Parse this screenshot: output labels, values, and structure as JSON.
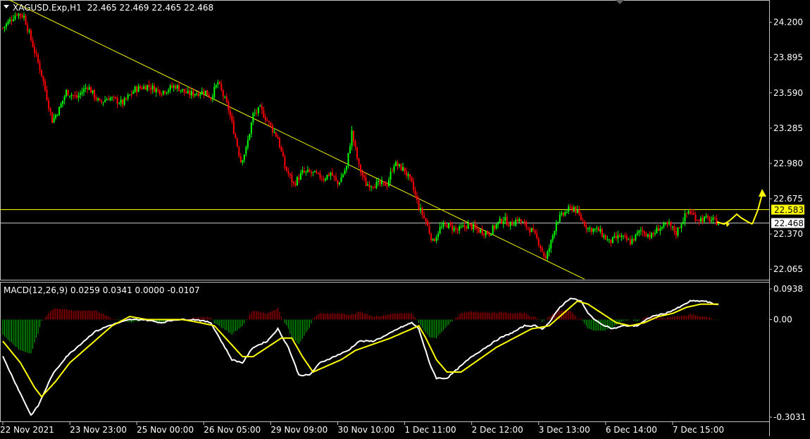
{
  "chart_data": [
    {
      "type": "candlestick",
      "title": "XAGUSD.Exp,H1",
      "ohlc_label": "22.465 22.469 22.465 22.468",
      "y_ticks": [
        "24.200",
        "23.895",
        "23.590",
        "23.285",
        "22.980",
        "22.675",
        "22.370",
        "22.065"
      ],
      "y_tick_values": [
        24.2,
        23.895,
        23.59,
        23.285,
        22.98,
        22.675,
        22.37,
        22.065
      ],
      "ylim": [
        21.975,
        24.38
      ],
      "price_levels": [
        {
          "value": 22.583,
          "label": "22.583",
          "color": "#ffff00",
          "label_bg": "#ffff00",
          "label_color": "#000000"
        },
        {
          "value": 22.468,
          "label": "22.468",
          "color": "#c0c0c0",
          "label_bg": "#ffffff",
          "label_color": "#000000"
        }
      ],
      "trendline": {
        "from": [
          0,
          24.42
        ],
        "to": [
          330,
          21.98
        ],
        "color": "#ffff00"
      },
      "bull_color": "#00ff00",
      "bear_color": "#ff0000",
      "anchors": [
        [
          0,
          24.15
        ],
        [
          8,
          24.28
        ],
        [
          12,
          24.25
        ],
        [
          18,
          23.95
        ],
        [
          22,
          23.75
        ],
        [
          28,
          23.35
        ],
        [
          32,
          23.45
        ],
        [
          36,
          23.6
        ],
        [
          42,
          23.55
        ],
        [
          48,
          23.65
        ],
        [
          55,
          23.5
        ],
        [
          60,
          23.55
        ],
        [
          68,
          23.5
        ],
        [
          75,
          23.62
        ],
        [
          82,
          23.65
        ],
        [
          90,
          23.6
        ],
        [
          98,
          23.65
        ],
        [
          105,
          23.58
        ],
        [
          115,
          23.6
        ],
        [
          118,
          23.55
        ],
        [
          122,
          23.68
        ],
        [
          128,
          23.45
        ],
        [
          132,
          23.2
        ],
        [
          135,
          23.0
        ],
        [
          138,
          23.1
        ],
        [
          142,
          23.4
        ],
        [
          146,
          23.45
        ],
        [
          150,
          23.35
        ],
        [
          156,
          23.2
        ],
        [
          160,
          22.95
        ],
        [
          165,
          22.8
        ],
        [
          170,
          22.9
        ],
        [
          175,
          22.9
        ],
        [
          182,
          22.85
        ],
        [
          186,
          22.9
        ],
        [
          190,
          22.8
        ],
        [
          195,
          22.95
        ],
        [
          198,
          23.25
        ],
        [
          202,
          22.95
        ],
        [
          206,
          22.8
        ],
        [
          212,
          22.8
        ],
        [
          218,
          22.8
        ],
        [
          222,
          22.98
        ],
        [
          228,
          22.92
        ],
        [
          232,
          22.8
        ],
        [
          236,
          22.6
        ],
        [
          240,
          22.48
        ],
        [
          244,
          22.3
        ],
        [
          248,
          22.42
        ],
        [
          252,
          22.45
        ],
        [
          258,
          22.4
        ],
        [
          264,
          22.45
        ],
        [
          270,
          22.4
        ],
        [
          276,
          22.38
        ],
        [
          280,
          22.45
        ],
        [
          284,
          22.5
        ],
        [
          288,
          22.45
        ],
        [
          292,
          22.5
        ],
        [
          296,
          22.45
        ],
        [
          300,
          22.4
        ],
        [
          304,
          22.3
        ],
        [
          308,
          22.15
        ],
        [
          311,
          22.3
        ],
        [
          314,
          22.48
        ],
        [
          320,
          22.57
        ],
        [
          324,
          22.6
        ],
        [
          328,
          22.5
        ],
        [
          332,
          22.42
        ],
        [
          338,
          22.4
        ],
        [
          344,
          22.3
        ],
        [
          350,
          22.35
        ],
        [
          356,
          22.3
        ],
        [
          362,
          22.4
        ],
        [
          368,
          22.35
        ],
        [
          372,
          22.42
        ],
        [
          378,
          22.45
        ],
        [
          382,
          22.38
        ],
        [
          386,
          22.5
        ],
        [
          389,
          22.57
        ],
        [
          394,
          22.5
        ],
        [
          400,
          22.5
        ],
        [
          406,
          22.47
        ]
      ],
      "x_ticks": [
        "22 Nov 2021",
        "23 Nov 23:00",
        "25 Nov 00:00",
        "26 Nov 05:00",
        "29 Nov 09:00",
        "30 Nov 10:00",
        "1 Dec 11:00",
        "2 Dec 12:00",
        "3 Dec 13:00",
        "6 Dec 14:00",
        "7 Dec 15:00"
      ],
      "x_tick_bars": [
        0,
        38,
        76,
        114,
        152,
        190,
        228,
        266,
        304,
        342,
        380
      ],
      "bar_count": 407,
      "projection_color": "#ffff00"
    },
    {
      "type": "macd",
      "label": "MACD(12,26,9) 0.0259 0.0341 0.0000 -0.0107",
      "y_ticks": [
        "0.0938",
        "0.00",
        "-0.3031"
      ],
      "y_tick_values": [
        0.0938,
        0.0,
        -0.3031
      ],
      "ylim": [
        -0.33,
        0.12
      ],
      "macd_color": "#ffffff",
      "signal_color": "#ffff00",
      "hist_up_color": "#ff0000",
      "hist_down_color": "#00ff00",
      "macd_anchors": [
        [
          0,
          -0.12
        ],
        [
          10,
          -0.24
        ],
        [
          16,
          -0.31
        ],
        [
          20,
          -0.28
        ],
        [
          28,
          -0.18
        ],
        [
          36,
          -0.12
        ],
        [
          44,
          -0.08
        ],
        [
          52,
          -0.04
        ],
        [
          60,
          -0.02
        ],
        [
          72,
          0
        ],
        [
          80,
          0
        ],
        [
          90,
          -0.01
        ],
        [
          98,
          0
        ],
        [
          110,
          0
        ],
        [
          118,
          -0.01
        ],
        [
          124,
          -0.07
        ],
        [
          130,
          -0.13
        ],
        [
          136,
          -0.14
        ],
        [
          142,
          -0.09
        ],
        [
          150,
          -0.07
        ],
        [
          156,
          -0.03
        ],
        [
          162,
          -0.09
        ],
        [
          168,
          -0.18
        ],
        [
          174,
          -0.18
        ],
        [
          180,
          -0.14
        ],
        [
          188,
          -0.12
        ],
        [
          196,
          -0.1
        ],
        [
          202,
          -0.07
        ],
        [
          210,
          -0.07
        ],
        [
          218,
          -0.05
        ],
        [
          224,
          -0.03
        ],
        [
          232,
          -0.01
        ],
        [
          236,
          -0.03
        ],
        [
          242,
          -0.14
        ],
        [
          246,
          -0.19
        ],
        [
          252,
          -0.19
        ],
        [
          258,
          -0.16
        ],
        [
          266,
          -0.12
        ],
        [
          274,
          -0.09
        ],
        [
          282,
          -0.06
        ],
        [
          290,
          -0.04
        ],
        [
          296,
          -0.02
        ],
        [
          302,
          -0.02
        ],
        [
          306,
          -0.03
        ],
        [
          310,
          -0.01
        ],
        [
          316,
          0.04
        ],
        [
          322,
          0.07
        ],
        [
          328,
          0.06
        ],
        [
          332,
          0.02
        ],
        [
          338,
          -0.01
        ],
        [
          346,
          -0.03
        ],
        [
          352,
          -0.02
        ],
        [
          360,
          -0.02
        ],
        [
          368,
          0.01
        ],
        [
          376,
          0.02
        ],
        [
          384,
          0.04
        ],
        [
          390,
          0.06
        ],
        [
          398,
          0.06
        ],
        [
          404,
          0.05
        ]
      ],
      "signal_anchors": [
        [
          0,
          -0.07
        ],
        [
          10,
          -0.14
        ],
        [
          18,
          -0.22
        ],
        [
          22,
          -0.25
        ],
        [
          30,
          -0.2
        ],
        [
          38,
          -0.14
        ],
        [
          46,
          -0.1
        ],
        [
          54,
          -0.06
        ],
        [
          62,
          -0.02
        ],
        [
          72,
          0.01
        ],
        [
          82,
          0
        ],
        [
          92,
          0
        ],
        [
          102,
          0
        ],
        [
          112,
          -0.01
        ],
        [
          120,
          -0.02
        ],
        [
          128,
          -0.07
        ],
        [
          136,
          -0.12
        ],
        [
          142,
          -0.12
        ],
        [
          150,
          -0.09
        ],
        [
          158,
          -0.06
        ],
        [
          164,
          -0.06
        ],
        [
          170,
          -0.12
        ],
        [
          176,
          -0.17
        ],
        [
          184,
          -0.15
        ],
        [
          192,
          -0.13
        ],
        [
          200,
          -0.1
        ],
        [
          210,
          -0.08
        ],
        [
          220,
          -0.06
        ],
        [
          228,
          -0.04
        ],
        [
          236,
          -0.02
        ],
        [
          240,
          -0.06
        ],
        [
          246,
          -0.13
        ],
        [
          252,
          -0.17
        ],
        [
          260,
          -0.17
        ],
        [
          270,
          -0.13
        ],
        [
          280,
          -0.09
        ],
        [
          290,
          -0.06
        ],
        [
          300,
          -0.03
        ],
        [
          310,
          -0.02
        ],
        [
          318,
          0.02
        ],
        [
          326,
          0.06
        ],
        [
          332,
          0.05
        ],
        [
          340,
          0.02
        ],
        [
          348,
          -0.01
        ],
        [
          356,
          -0.02
        ],
        [
          364,
          -0.01
        ],
        [
          372,
          0.01
        ],
        [
          380,
          0.02
        ],
        [
          388,
          0.04
        ],
        [
          396,
          0.05
        ],
        [
          404,
          0.05
        ]
      ]
    }
  ]
}
